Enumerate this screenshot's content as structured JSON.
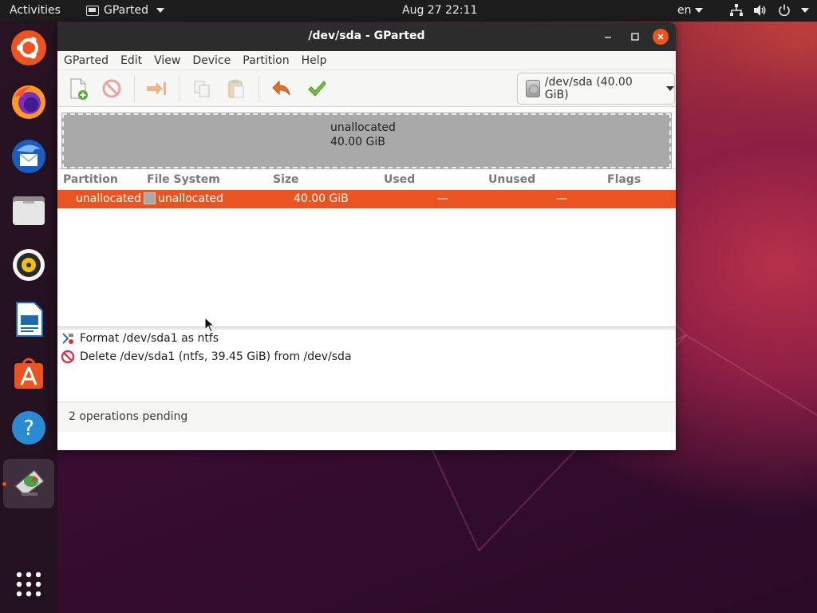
{
  "topbar": {
    "activities": "Activities",
    "app_name": "GParted",
    "clock": "Aug 27  22:11",
    "language": "en"
  },
  "dock": {
    "items": [
      "ubuntu-software-center-logo",
      "firefox",
      "thunderbird",
      "files",
      "rhythmbox",
      "libreoffice-writer",
      "ubuntu-software",
      "help",
      "gparted"
    ],
    "active": "gparted"
  },
  "window": {
    "title": "/dev/sda - GParted",
    "menu": {
      "gparted": "GParted",
      "edit": "Edit",
      "view": "View",
      "device": "Device",
      "partition": "Partition",
      "help": "Help"
    },
    "device_selector": "/dev/sda (40.00 GiB)",
    "disk_map": {
      "label": "unallocated",
      "size": "40.00 GiB",
      "color": "#a9a9a9"
    },
    "columns": {
      "partition": "Partition",
      "file_system": "File System",
      "size": "Size",
      "used": "Used",
      "unused": "Unused",
      "flags": "Flags"
    },
    "rows": [
      {
        "partition": "unallocated",
        "file_system": "unallocated",
        "size": "40.00 GiB",
        "used": "—",
        "unused": "—",
        "flags": ""
      }
    ],
    "operations": [
      {
        "text": "Format /dev/sda1 as ntfs",
        "icon": "format-icon"
      },
      {
        "text": "Delete /dev/sda1 (ntfs, 39.45 GiB) from /dev/sda",
        "icon": "delete-icon"
      }
    ],
    "status": "2 operations pending"
  },
  "colors": {
    "accent": "#e95420",
    "unallocated": "#a9a9a9",
    "titlebar": "#2c2c2c"
  }
}
